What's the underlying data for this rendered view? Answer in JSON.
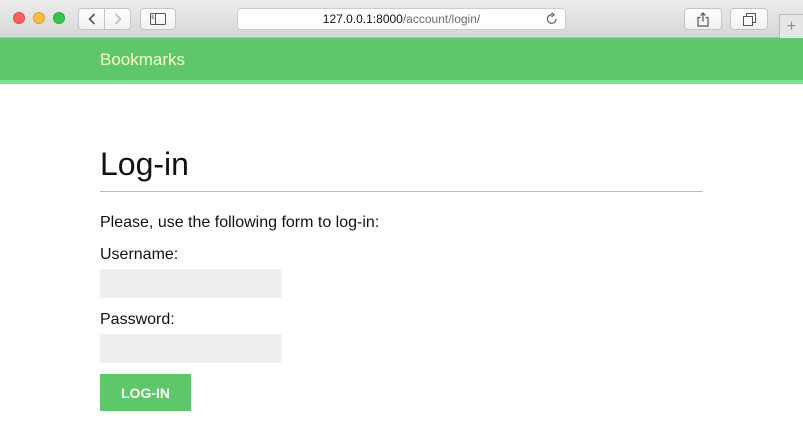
{
  "browser": {
    "url_host": "127.0.0.1:8000",
    "url_path": "/account/login/",
    "icons": {
      "back": "chevron-left-icon",
      "forward": "chevron-right-icon",
      "sidebar": "sidebar-icon",
      "reload": "reload-icon",
      "share": "share-icon",
      "tabs": "tabs-icon",
      "new_tab": "plus-icon"
    }
  },
  "header": {
    "logo": "Bookmarks",
    "background": "#5ec76a",
    "logo_color": "#f8ffc8"
  },
  "main": {
    "title": "Log-in",
    "intro": "Please, use the following form to log-in:",
    "username_label": "Username:",
    "username_value": "",
    "password_label": "Password:",
    "password_value": "",
    "submit_label": "LOG-IN"
  }
}
